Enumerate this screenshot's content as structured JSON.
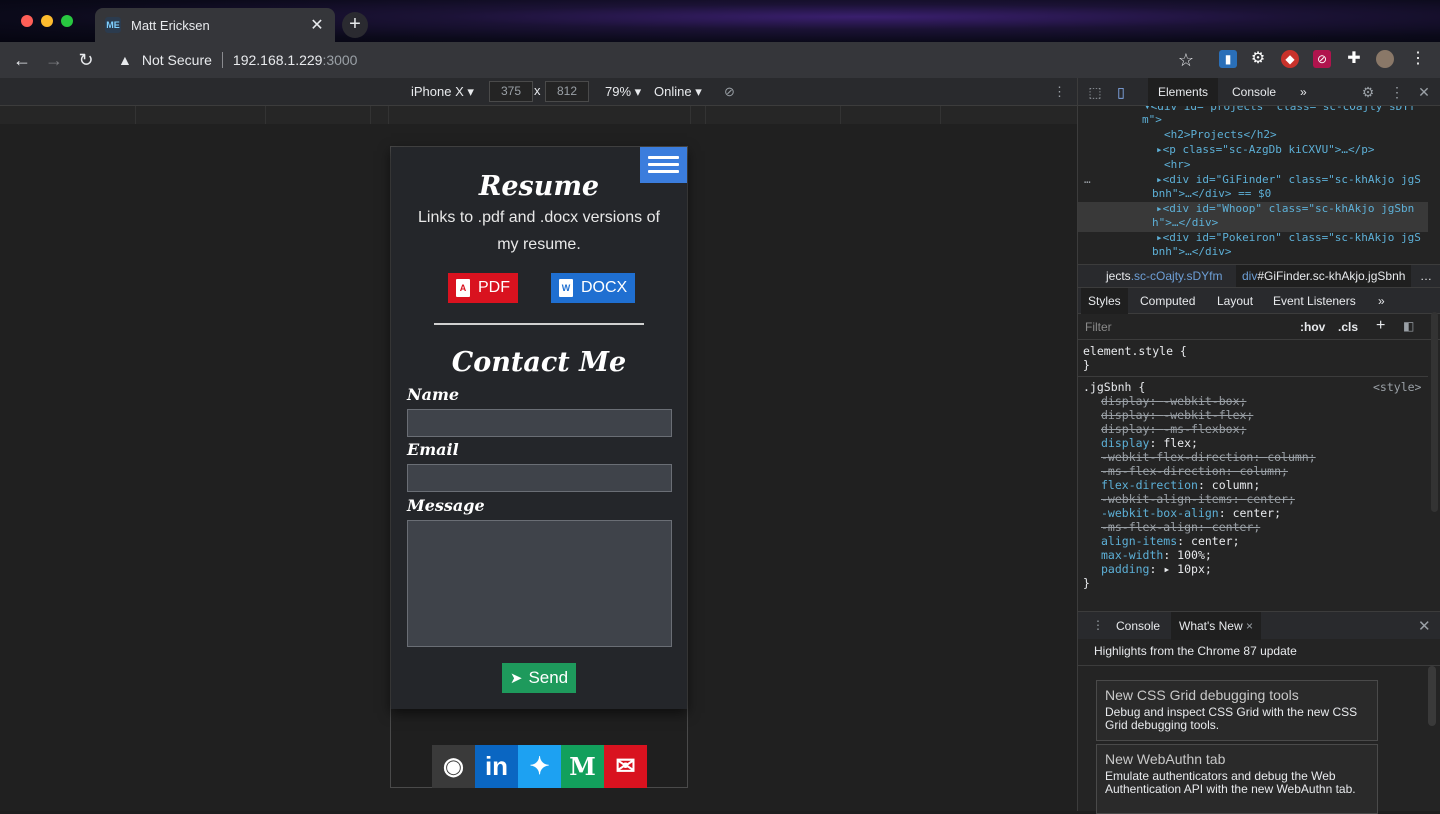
{
  "browser": {
    "tab_title": "Matt Ericksen",
    "tab_favicon": "ME",
    "security_label": "Not Secure",
    "url_host": "192.168.1.229",
    "url_port": ":3000"
  },
  "device_toolbar": {
    "device": "iPhone X ▾",
    "width": "375",
    "height": "812",
    "times": "x",
    "zoom": "79% ▾",
    "network": "Online ▾"
  },
  "page": {
    "resume": {
      "title": "Resume",
      "subtitle": "Links to .pdf and .docx versions of my resume.",
      "pdf_label": "PDF",
      "docx_label": "DOCX"
    },
    "contact": {
      "title": "Contact Me",
      "name_label": "Name",
      "email_label": "Email",
      "message_label": "Message",
      "send_label": "Send"
    },
    "socials": [
      {
        "name": "github-icon",
        "glyph": "◉",
        "color": "#3a3a3a"
      },
      {
        "name": "linkedin-icon",
        "glyph": "in",
        "color": "#0a66c2"
      },
      {
        "name": "twitter-icon",
        "glyph": "🐦",
        "color": "#1da1f2"
      },
      {
        "name": "medium-icon",
        "glyph": "M",
        "color": "#12a05c"
      },
      {
        "name": "email-icon",
        "glyph": "✉",
        "color": "#d9121f"
      }
    ]
  },
  "devtools": {
    "tabs": {
      "elements": "Elements",
      "console": "Console",
      "more": "»"
    },
    "dom": {
      "l0_tag": "▾<div id=\"projects\" class=\"sc-cOajty sDYf",
      "l0b": "m\">",
      "l1": "<h2>Projects</h2>",
      "l2": "▸<p class=\"sc-AzgDb kiCXVU\">…</p>",
      "l3": "<hr>",
      "l4a": "▸<div id=\"GiFinder\" class=\"sc-khAkjo jgS",
      "l4b": "bnh\">…</div> == $0",
      "l5a": "▸<div id=\"Whoop\" class=\"sc-khAkjo jgSbn",
      "l5b": "h\">…</div>",
      "l6a": "▸<div id=\"Pokeiron\" class=\"sc-khAkjo jgS",
      "l6b": "bnh\">…</div>",
      "dots": "…"
    },
    "breadcrumbs": {
      "c1_a": "jects",
      "c1_b": ".sc-cOajty.sDYfm",
      "c2_a": "div",
      "c2_b": "#GiFinder.sc-khAkjo.jgSbnh",
      "more": "…"
    },
    "subtabs": {
      "styles": "Styles",
      "computed": "Computed",
      "layout": "Layout",
      "listeners": "Event Listeners",
      "more": "»"
    },
    "filter": {
      "placeholder": "Filter",
      "hov": ":hov",
      "cls": ".cls",
      "plus": "+"
    },
    "styles": {
      "element_style": "element.style {",
      "close": "}",
      "selector": ".jgSbnh {",
      "source": "<style>",
      "rules": [
        {
          "prop": "display",
          "value": "-webkit-box;",
          "struck": true
        },
        {
          "prop": "display",
          "value": "-webkit-flex;",
          "struck": true
        },
        {
          "prop": "display",
          "value": "-ms-flexbox;",
          "struck": true
        },
        {
          "prop": "display",
          "value": "flex;",
          "struck": false
        },
        {
          "prop": "-webkit-flex-direction",
          "value": "column;",
          "struck": true
        },
        {
          "prop": "-ms-flex-direction",
          "value": "column;",
          "struck": true
        },
        {
          "prop": "flex-direction",
          "value": "column;",
          "struck": false
        },
        {
          "prop": "-webkit-align-items",
          "value": "center;",
          "struck": true
        },
        {
          "prop": "-webkit-box-align",
          "value": "center;",
          "struck": false
        },
        {
          "prop": "-ms-flex-align",
          "value": "center;",
          "struck": true
        },
        {
          "prop": "align-items",
          "value": "center;",
          "struck": false
        },
        {
          "prop": "max-width",
          "value": "100%;",
          "struck": false
        },
        {
          "prop": "padding",
          "value": "▸ 10px;",
          "struck": false
        }
      ]
    },
    "drawer": {
      "console": "Console",
      "whats_new": "What's New",
      "close_x": "×",
      "highlights": "Highlights from the Chrome 87 update",
      "cards": [
        {
          "head": "New CSS Grid debugging tools",
          "body": "Debug and inspect CSS Grid with the new CSS Grid debugging tools."
        },
        {
          "head": "New WebAuthn tab",
          "body": "Emulate authenticators and debug the Web Authentication API with the new WebAuthn tab."
        }
      ]
    }
  }
}
